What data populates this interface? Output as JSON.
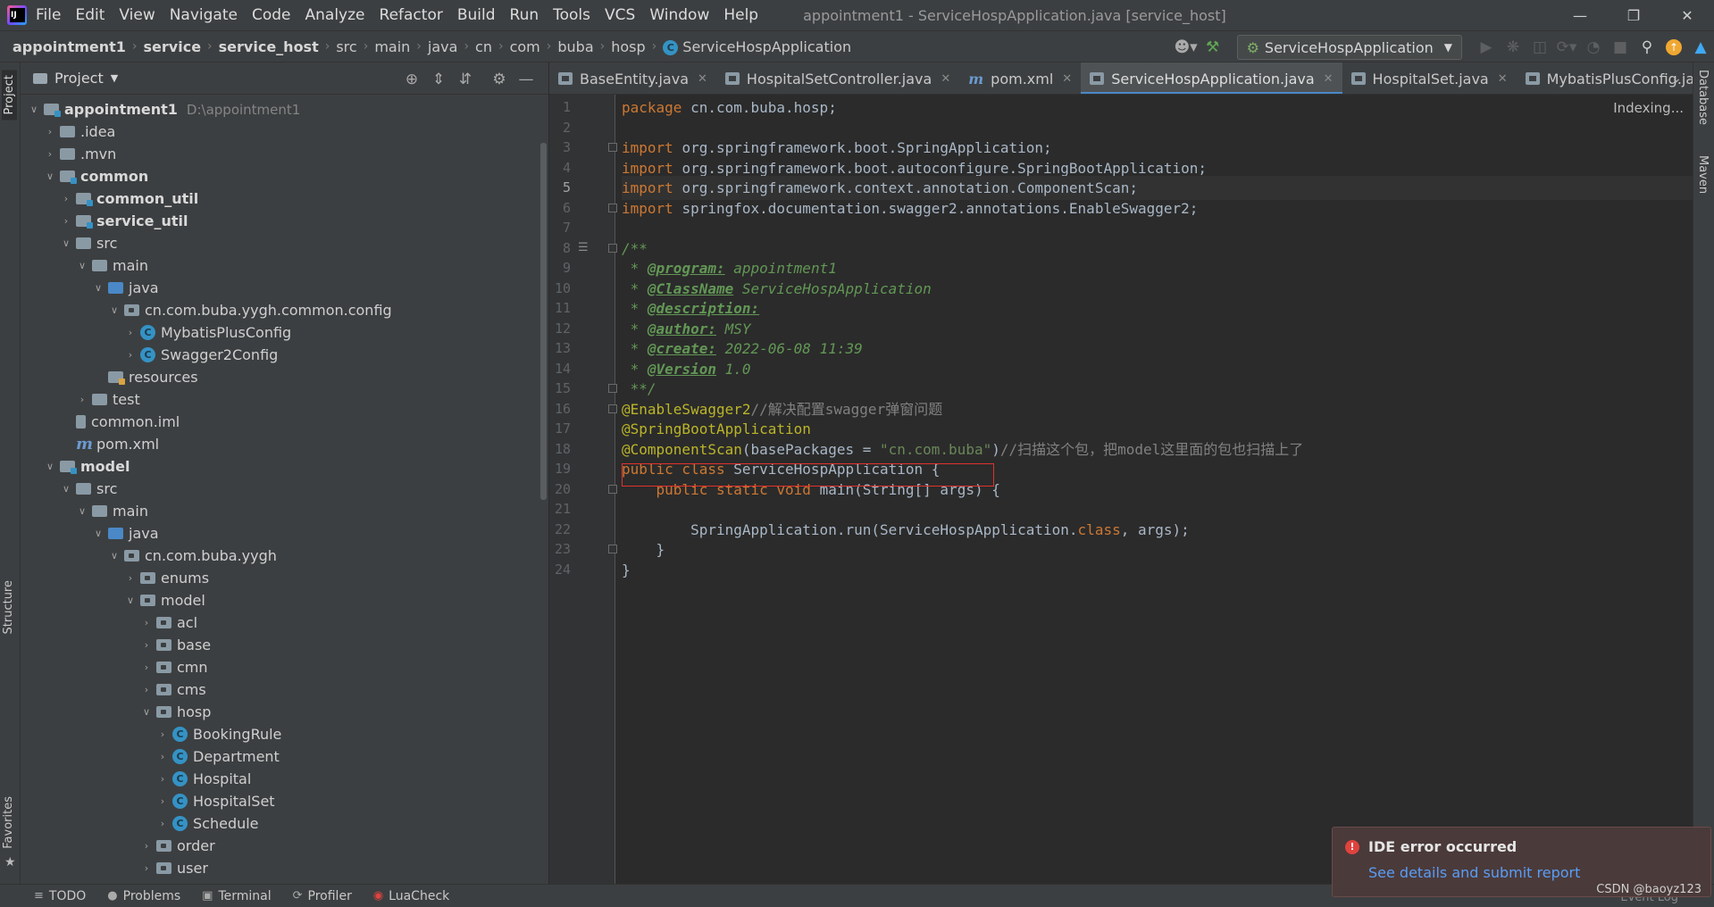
{
  "menubar": {
    "items": [
      "File",
      "Edit",
      "View",
      "Navigate",
      "Code",
      "Analyze",
      "Refactor",
      "Build",
      "Run",
      "Tools",
      "VCS",
      "Window",
      "Help"
    ],
    "window_title": "appointment1 - ServiceHospApplication.java [service_host]"
  },
  "breadcrumb": {
    "items": [
      "appointment1",
      "service",
      "service_host",
      "src",
      "main",
      "java",
      "cn",
      "com",
      "buba",
      "hosp"
    ],
    "current": "ServiceHospApplication"
  },
  "run_config": {
    "label": "ServiceHospApplication"
  },
  "left_strip": {
    "project": "Project",
    "structure": "Structure",
    "favorites": "Favorites"
  },
  "right_strip": {
    "database": "Database",
    "maven": "Maven"
  },
  "project_panel": {
    "title": "Project",
    "tree": [
      {
        "label": "appointment1",
        "path": "D:\\appointment1",
        "icon": "module",
        "level": 0,
        "chev": "open",
        "bold": true
      },
      {
        "label": ".idea",
        "icon": "plain",
        "level": 1,
        "chev": "closed"
      },
      {
        "label": ".mvn",
        "icon": "plain",
        "level": 1,
        "chev": "closed"
      },
      {
        "label": "common",
        "icon": "module",
        "level": 1,
        "chev": "open",
        "bold": true
      },
      {
        "label": "common_util",
        "icon": "module",
        "level": 2,
        "chev": "closed",
        "bold": true
      },
      {
        "label": "service_util",
        "icon": "module",
        "level": 2,
        "chev": "closed",
        "bold": true
      },
      {
        "label": "src",
        "icon": "plain",
        "level": 2,
        "chev": "open"
      },
      {
        "label": "main",
        "icon": "plain",
        "level": 3,
        "chev": "open"
      },
      {
        "label": "java",
        "icon": "src",
        "level": 4,
        "chev": "open"
      },
      {
        "label": "cn.com.buba.yygh.common.config",
        "icon": "pkg",
        "level": 5,
        "chev": "open"
      },
      {
        "label": "MybatisPlusConfig",
        "icon": "class",
        "level": 6,
        "chev": "closed"
      },
      {
        "label": "Swagger2Config",
        "icon": "class",
        "level": 6,
        "chev": "closed"
      },
      {
        "label": "resources",
        "icon": "res",
        "level": 4,
        "chev": "none"
      },
      {
        "label": "test",
        "icon": "plain",
        "level": 3,
        "chev": "closed"
      },
      {
        "label": "common.iml",
        "icon": "iml",
        "level": 2,
        "chev": "none"
      },
      {
        "label": "pom.xml",
        "icon": "maven",
        "level": 2,
        "chev": "none"
      },
      {
        "label": "model",
        "icon": "module",
        "level": 1,
        "chev": "open",
        "bold": true
      },
      {
        "label": "src",
        "icon": "plain",
        "level": 2,
        "chev": "open"
      },
      {
        "label": "main",
        "icon": "plain",
        "level": 3,
        "chev": "open"
      },
      {
        "label": "java",
        "icon": "src",
        "level": 4,
        "chev": "open"
      },
      {
        "label": "cn.com.buba.yygh",
        "icon": "pkg",
        "level": 5,
        "chev": "open"
      },
      {
        "label": "enums",
        "icon": "pkg",
        "level": 6,
        "chev": "closed"
      },
      {
        "label": "model",
        "icon": "pkg",
        "level": 6,
        "chev": "open"
      },
      {
        "label": "acl",
        "icon": "pkg",
        "level": 7,
        "chev": "closed"
      },
      {
        "label": "base",
        "icon": "pkg",
        "level": 7,
        "chev": "closed"
      },
      {
        "label": "cmn",
        "icon": "pkg",
        "level": 7,
        "chev": "closed"
      },
      {
        "label": "cms",
        "icon": "pkg",
        "level": 7,
        "chev": "closed"
      },
      {
        "label": "hosp",
        "icon": "pkg",
        "level": 7,
        "chev": "open"
      },
      {
        "label": "BookingRule",
        "icon": "class",
        "level": 8,
        "chev": "closed"
      },
      {
        "label": "Department",
        "icon": "class",
        "level": 8,
        "chev": "closed"
      },
      {
        "label": "Hospital",
        "icon": "class",
        "level": 8,
        "chev": "closed"
      },
      {
        "label": "HospitalSet",
        "icon": "class",
        "level": 8,
        "chev": "closed"
      },
      {
        "label": "Schedule",
        "icon": "class",
        "level": 8,
        "chev": "closed"
      },
      {
        "label": "order",
        "icon": "pkg",
        "level": 7,
        "chev": "closed"
      },
      {
        "label": "user",
        "icon": "pkg",
        "level": 7,
        "chev": "closed"
      }
    ]
  },
  "editor_tabs": [
    {
      "label": "BaseEntity.java",
      "icon": "java",
      "active": false
    },
    {
      "label": "HospitalSetController.java",
      "icon": "java",
      "active": false
    },
    {
      "label": "pom.xml",
      "icon": "maven",
      "active": false
    },
    {
      "label": "ServiceHospApplication.java",
      "icon": "java",
      "active": true
    },
    {
      "label": "HospitalSet.java",
      "icon": "java",
      "active": false
    },
    {
      "label": "MybatisPlusConfig.java",
      "icon": "java",
      "active": false
    }
  ],
  "editor": {
    "status": "Indexing...",
    "current_line": 5,
    "lines": [
      [
        [
          "kw",
          "package "
        ],
        [
          "t",
          "cn.com.buba.hosp;"
        ]
      ],
      [],
      [
        [
          "kw",
          "import "
        ],
        [
          "t",
          "org.springframework.boot.SpringApplication;"
        ]
      ],
      [
        [
          "kw",
          "import "
        ],
        [
          "t",
          "org.springframework.boot.autoconfigure.SpringBootApplication;"
        ]
      ],
      [
        [
          "kw",
          "import "
        ],
        [
          "t",
          "org.springframework.context.annotation.ComponentScan;"
        ]
      ],
      [
        [
          "kw",
          "import "
        ],
        [
          "t",
          "springfox.documentation.swagger2.annotations.EnableSwagger2;"
        ]
      ],
      [],
      [
        [
          "doc",
          "/**"
        ]
      ],
      [
        [
          "doc",
          " * "
        ],
        [
          "doctag",
          "@program:"
        ],
        [
          "doctxt",
          " appointment1"
        ]
      ],
      [
        [
          "doc",
          " * "
        ],
        [
          "doctag",
          "@ClassName"
        ],
        [
          "doctxt",
          " ServiceHospApplication"
        ]
      ],
      [
        [
          "doc",
          " * "
        ],
        [
          "doctag",
          "@description:"
        ]
      ],
      [
        [
          "doc",
          " * "
        ],
        [
          "doctag",
          "@author:"
        ],
        [
          "doctxt",
          " MSY"
        ]
      ],
      [
        [
          "doc",
          " * "
        ],
        [
          "doctag",
          "@create:"
        ],
        [
          "doctxt",
          " 2022-06-08 11:39"
        ]
      ],
      [
        [
          "doc",
          " * "
        ],
        [
          "doctag",
          "@Version"
        ],
        [
          "doctxt",
          " 1.0"
        ]
      ],
      [
        [
          "doc",
          " **/"
        ]
      ],
      [
        [
          "ann",
          "@EnableSwagger2"
        ],
        [
          "cmt",
          "//解决配置swagger弹窗问题"
        ]
      ],
      [
        [
          "ann",
          "@SpringBootApplication"
        ]
      ],
      [
        [
          "ann",
          "@ComponentScan"
        ],
        [
          "t",
          "(basePackages = "
        ],
        [
          "str",
          "\"cn.com.buba\""
        ],
        [
          "t",
          ")"
        ],
        [
          "cmt",
          "//扫描这个包，把model这里面的包也扫描上了"
        ]
      ],
      [
        [
          "kw",
          "public class "
        ],
        [
          "t",
          "ServiceHospApplication {"
        ]
      ],
      [
        [
          "t",
          "    "
        ],
        [
          "kw",
          "public static void "
        ],
        [
          "t",
          "main(String[] args) {"
        ]
      ],
      [],
      [
        [
          "t",
          "        SpringApplication.run(ServiceHospApplication."
        ],
        [
          "kw",
          "class"
        ],
        [
          "t",
          ", args);"
        ]
      ],
      [
        [
          "t",
          "    }"
        ]
      ],
      [
        [
          "t",
          "}"
        ]
      ]
    ]
  },
  "bottom_bar": [
    "TODO",
    "Problems",
    "Terminal",
    "Profiler",
    "LuaCheck"
  ],
  "notification": {
    "title": "IDE error occurred",
    "link": "See details and submit report"
  },
  "watermark": "CSDN @baoyz123",
  "event_log": "Event Log"
}
